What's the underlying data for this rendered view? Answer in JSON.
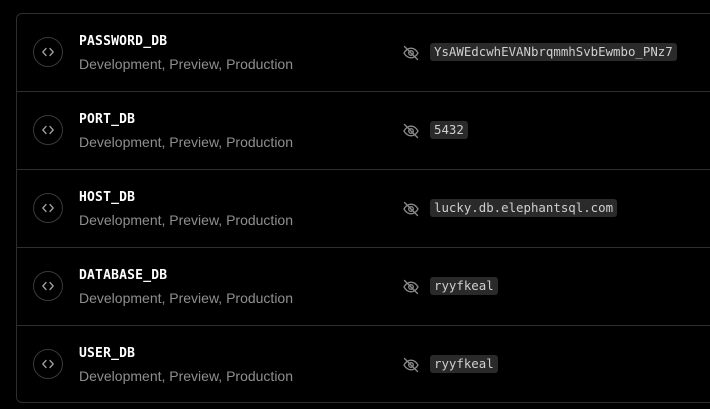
{
  "env_vars": [
    {
      "name": "PASSWORD_DB",
      "targets": "Development, Preview, Production",
      "value": "YsAWEdcwhEVANbrqmmhSvbEwmbo_PNz7",
      "icon": "code-icon",
      "visibility_icon": "eye-off-icon"
    },
    {
      "name": "PORT_DB",
      "targets": "Development, Preview, Production",
      "value": "5432",
      "icon": "code-icon",
      "visibility_icon": "eye-off-icon"
    },
    {
      "name": "HOST_DB",
      "targets": "Development, Preview, Production",
      "value": "lucky.db.elephantsql.com",
      "icon": "code-icon",
      "visibility_icon": "eye-off-icon"
    },
    {
      "name": "DATABASE_DB",
      "targets": "Development, Preview, Production",
      "value": "ryyfkeal",
      "icon": "code-icon",
      "visibility_icon": "eye-off-icon"
    },
    {
      "name": "USER_DB",
      "targets": "Development, Preview, Production",
      "value": "ryyfkeal",
      "icon": "code-icon",
      "visibility_icon": "eye-off-icon"
    }
  ],
  "colors": {
    "background": "#000000",
    "border": "#2e2e2e",
    "name_text": "#ffffff",
    "secondary_text": "#8f8f8f",
    "value_bg": "#2a2a2a",
    "value_text": "#cfcfcf"
  }
}
